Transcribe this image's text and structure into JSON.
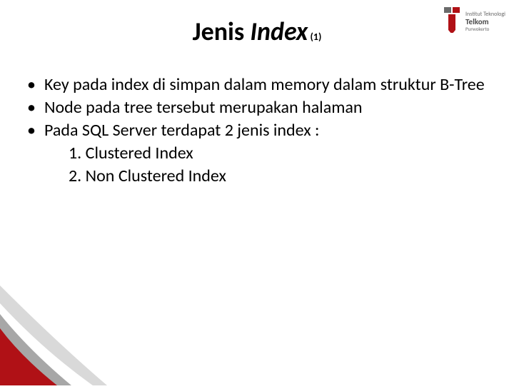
{
  "title": {
    "word1": "Jenis ",
    "word2": "Index",
    "counter": " (1)"
  },
  "logo": {
    "line1": "Institut Teknologi",
    "line2": "Telkom",
    "line3": "Purwokerto"
  },
  "bullets": [
    "Key pada index di simpan dalam memory dalam struktur B-Tree",
    "Node pada tree tersebut merupakan halaman",
    "Pada SQL Server terdapat 2 jenis index :"
  ],
  "numbered": [
    "1.  Clustered Index",
    "2.  Non Clustered Index"
  ]
}
